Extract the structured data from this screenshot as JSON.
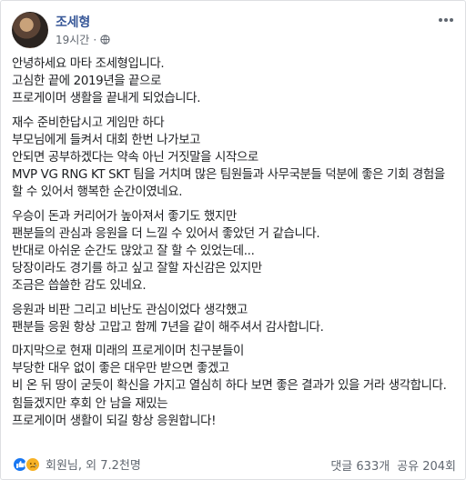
{
  "post": {
    "author": "조세형",
    "time": "19시간",
    "privacy_icon": "globe-icon",
    "more_icon": "more-options-icon",
    "paragraphs": [
      [
        "안녕하세요 마타 조세형입니다.",
        "고심한 끝에 2019년을 끝으로",
        "프로게이머 생활을 끝내게 되었습니다."
      ],
      [
        "재수 준비한답시고 게임만 하다",
        "부모님에게 들켜서 대회 한번 나가보고",
        "안되면 공부하겠다는 약속 아닌 거짓말을 시작으로",
        "MVP VG RNG KT SKT 팀을 거치며 많은 팀원들과 사무국분들 덕분에 좋은 기회 경험을 할 수 있어서 행복한 순간이였네요."
      ],
      [
        "우승이 돈과 커리어가 높아져서 좋기도 했지만",
        "팬분들의 관심과 응원을 더 느낄 수 있어서 좋았던 거 같습니다.",
        "반대로 아쉬운 순간도 많았고 잘 할 수 있었는데...",
        "당장이라도 경기를 하고 싶고 잘할 자신감은 있지만",
        "조금은 씁쓸한 감도 있네요."
      ],
      [
        "응원과 비판 그리고 비난도 관심이었다 생각했고",
        "팬분들 응원 항상 고맙고 함께 7년을 같이 해주셔서 감사합니다."
      ],
      [
        "마지막으로 현재 미래의 프로게이머 친구분들이",
        "부당한 대우 없이 좋은 대우만 받으면 좋겠고",
        "비 온 뒤 땅이 굳듯이 확신을 가지고 열심히 하다 보면 좋은 결과가 있을 거라 생각합니다.",
        "힘들겠지만 후회 안 남을 재밌는",
        "프로게이머 생활이 되길 항상 응원합니다!"
      ]
    ]
  },
  "reactions": {
    "icons": [
      "like-icon",
      "sad-icon"
    ],
    "summary": "회원님, 외 7.2천명"
  },
  "stats": {
    "comments": "댓글 633개",
    "shares": "공유 204회"
  }
}
